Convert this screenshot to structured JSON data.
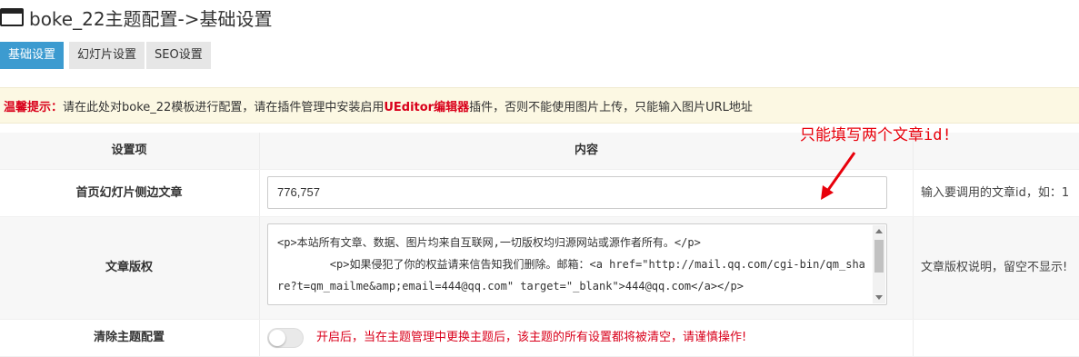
{
  "page": {
    "title": "boke_22主题配置->基础设置"
  },
  "tabs": [
    {
      "label": "基础设置",
      "active": true
    },
    {
      "label": "幻灯片设置",
      "active": false
    },
    {
      "label": "SEO设置",
      "active": false
    }
  ],
  "notice": {
    "prefix": "温馨提示：",
    "text_before": "请在此处对boke_22模板进行配置，请在插件管理中安装启用",
    "highlight": "UEditor编辑器",
    "text_after": "插件，否则不能使用图片上传，只能输入图片URL地址"
  },
  "table": {
    "headers": {
      "setting": "设置项",
      "content": "内容"
    },
    "rows": [
      {
        "label": "首页幻灯片侧边文章",
        "value": "776,757",
        "help": "输入要调用的文章id，如：1"
      },
      {
        "label": "文章版权",
        "lines": [
          "<p>本站所有文章、数据、图片均来自互联网,一切版权均归源网站或源作者所有。</p>",
          "        <p>如果侵犯了你的权益请来信告知我们删除。邮箱：<a href=\"http://mail.qq.com/cgi-bin/qm_share?t=qm_mailme&amp;email=444@qq.com\" target=\"_blank\">444@qq.com</a></p>"
        ],
        "help": "文章版权说明，留空不显示!"
      },
      {
        "label": "清除主题配置",
        "toggle_on": false,
        "warning": "开启后，当在主题管理中更换主题后，该主题的所有设置都将被清空，请谨慎操作!"
      }
    ]
  },
  "annotation": {
    "text": "只能填写两个文章id!",
    "color": "#e8000b"
  },
  "colors": {
    "accent": "#3c9bd0",
    "notice_bg": "#fcf8e3",
    "warning_red": "#d9001b"
  }
}
